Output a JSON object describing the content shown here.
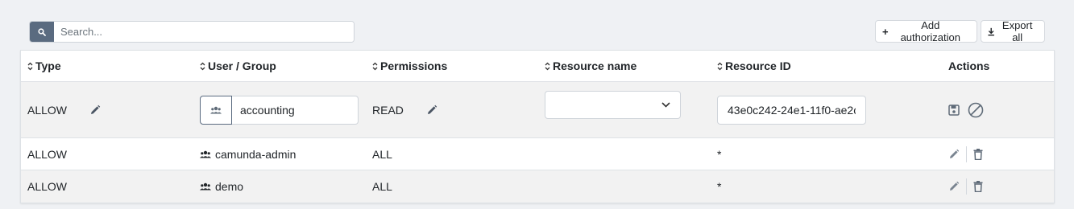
{
  "search": {
    "placeholder": "Search..."
  },
  "toolbar": {
    "add_label": "Add authorization",
    "export_label": "Export all"
  },
  "table": {
    "headers": [
      "Type",
      "User / Group",
      "Permissions",
      "Resource name",
      "Resource ID",
      "Actions"
    ],
    "edit_row": {
      "type": "ALLOW",
      "user_group": "accounting",
      "permissions": "READ",
      "resource_name": "",
      "resource_id": "43e0c242-24e1-11f0-ae2c"
    },
    "rows": [
      {
        "type": "ALLOW",
        "user_group": "camunda-admin",
        "permissions": "ALL",
        "resource_id": "*"
      },
      {
        "type": "ALLOW",
        "user_group": "demo",
        "permissions": "ALL",
        "resource_id": "*"
      }
    ]
  },
  "colors": {
    "accent": "#5a6b80",
    "row_alt": "#f2f2f2",
    "icon": "#5f6b78"
  }
}
